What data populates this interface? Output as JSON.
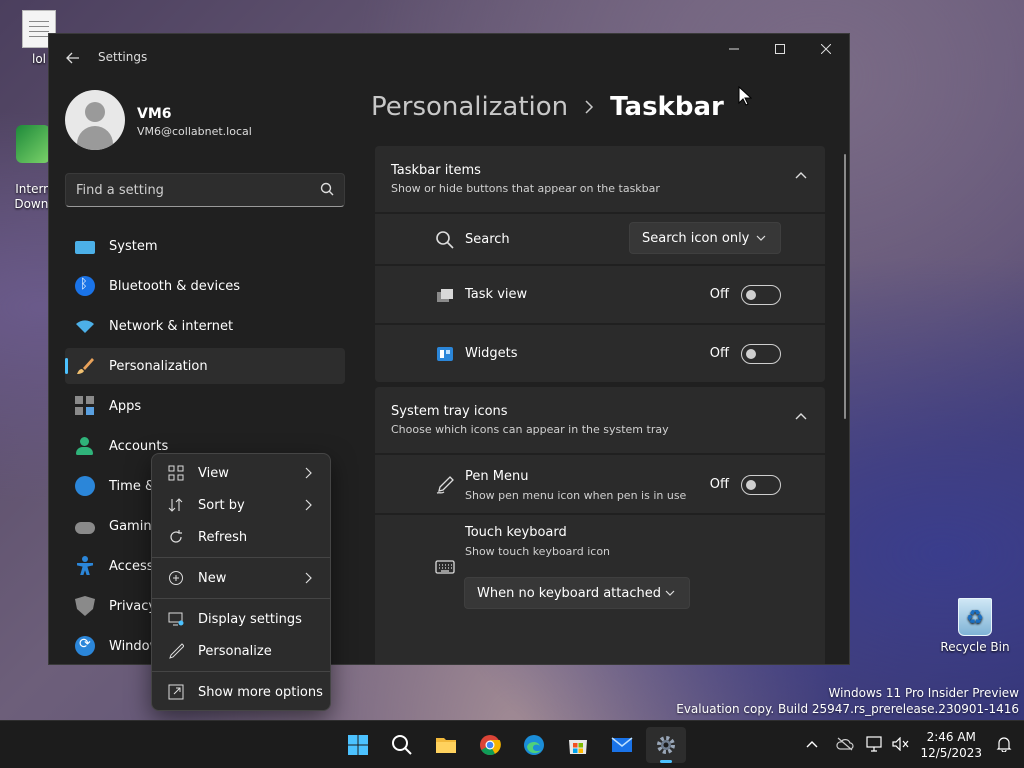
{
  "desktop": {
    "icons": [
      {
        "label": "lol"
      },
      {
        "label": "Intern\nDownl"
      },
      {
        "label": "Recycle Bin"
      }
    ],
    "watermark": {
      "line1": "Windows 11 Pro Insider Preview",
      "line2": "Evaluation copy. Build 25947.rs_prerelease.230901-1416"
    }
  },
  "window": {
    "title": "Settings",
    "profile": {
      "name": "VM6",
      "email": "VM6@collabnet.local"
    },
    "search": {
      "placeholder": "Find a setting"
    },
    "nav": [
      {
        "label": "System",
        "icon": "monitor-icon"
      },
      {
        "label": "Bluetooth & devices",
        "icon": "bluetooth-icon"
      },
      {
        "label": "Network & internet",
        "icon": "wifi-icon"
      },
      {
        "label": "Personalization",
        "icon": "brush-icon",
        "active": true
      },
      {
        "label": "Apps",
        "icon": "apps-icon"
      },
      {
        "label": "Accounts",
        "icon": "person-icon"
      },
      {
        "label": "Time & language",
        "icon": "globe-clock-icon"
      },
      {
        "label": "Gaming",
        "icon": "gamepad-icon"
      },
      {
        "label": "Accessibility",
        "icon": "accessibility-icon"
      },
      {
        "label": "Privacy & security",
        "icon": "shield-icon"
      },
      {
        "label": "Windows Update",
        "icon": "update-icon"
      }
    ],
    "breadcrumb": {
      "parent": "Personalization",
      "current": "Taskbar"
    },
    "taskbar_items": {
      "title": "Taskbar items",
      "description": "Show or hide buttons that appear on the taskbar",
      "search": {
        "label": "Search",
        "value": "Search icon only"
      },
      "task_view": {
        "label": "Task view",
        "state": "Off"
      },
      "widgets": {
        "label": "Widgets",
        "state": "Off"
      }
    },
    "system_tray": {
      "title": "System tray icons",
      "description": "Choose which icons can appear in the system tray",
      "pen_menu": {
        "label": "Pen Menu",
        "sub": "Show pen menu icon when pen is in use",
        "state": "Off"
      },
      "touch_keyboard": {
        "label": "Touch keyboard",
        "sub": "Show touch keyboard icon",
        "value": "When no keyboard attached"
      }
    }
  },
  "context_menu": {
    "items": [
      {
        "label": "View",
        "icon": "grid-icon",
        "submenu": true
      },
      {
        "label": "Sort by",
        "icon": "sort-icon",
        "submenu": true
      },
      {
        "label": "Refresh",
        "icon": "refresh-icon"
      },
      {
        "label": "New",
        "icon": "plus-circle-icon",
        "submenu": true
      },
      {
        "label": "Display settings",
        "icon": "display-icon"
      },
      {
        "label": "Personalize",
        "icon": "pen-icon"
      },
      {
        "label": "Show more options",
        "icon": "open-external-icon"
      }
    ]
  },
  "taskbar": {
    "clock": {
      "time": "2:46 AM",
      "date": "12/5/2023"
    }
  },
  "colors": {
    "accent": "#4cc2ff",
    "surface": "#2b2b2b",
    "window": "#202020"
  }
}
